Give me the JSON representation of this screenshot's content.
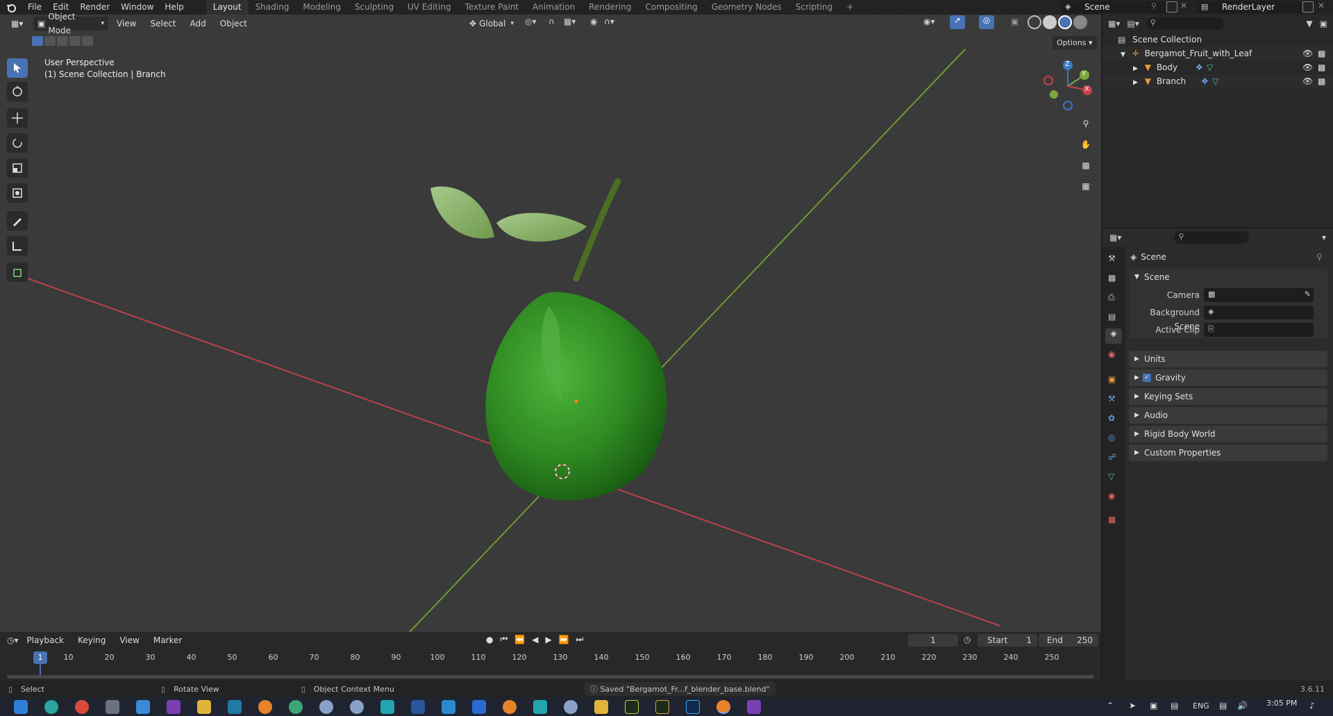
{
  "topbar": {
    "menus": [
      "File",
      "Edit",
      "Render",
      "Window",
      "Help"
    ],
    "workspaces": [
      "Layout",
      "Shading",
      "Modeling",
      "Sculpting",
      "UV Editing",
      "Texture Paint",
      "Animation",
      "Rendering",
      "Compositing",
      "Geometry Nodes",
      "Scripting"
    ],
    "active_workspace": "Layout",
    "add_tab": "+",
    "scene": "Scene",
    "view_layer": "RenderLayer"
  },
  "viewport": {
    "mode": "Object Mode",
    "menus": [
      "View",
      "Select",
      "Add",
      "Object"
    ],
    "orientation": "Global",
    "options": "Options",
    "info_line1": "User Perspective",
    "info_line2": "(1) Scene Collection | Branch",
    "gizmo_axes": [
      "X",
      "Y",
      "Z"
    ]
  },
  "outliner": {
    "root": "Scene Collection",
    "items": [
      {
        "name": "Bergamot_Fruit_with_Leaf",
        "icon": "empty-icon"
      },
      {
        "name": "Body",
        "icon": "mesh-icon"
      },
      {
        "name": "Branch",
        "icon": "mesh-icon"
      }
    ]
  },
  "properties": {
    "context": "Scene",
    "section": "Scene",
    "fields": [
      {
        "label": "Camera",
        "value": ""
      },
      {
        "label": "Background Scene",
        "value": ""
      },
      {
        "label": "Active Clip",
        "value": ""
      }
    ],
    "panels": [
      "Units",
      "Gravity",
      "Keying Sets",
      "Audio",
      "Rigid Body World",
      "Custom Properties"
    ],
    "gravity_enabled": true
  },
  "timeline": {
    "menus": [
      "Playback",
      "Keying",
      "View",
      "Marker"
    ],
    "current_frame": "1",
    "start_label": "Start",
    "start": "1",
    "end_label": "End",
    "end": "250",
    "ticks": [
      "1",
      "10",
      "20",
      "30",
      "40",
      "50",
      "60",
      "70",
      "80",
      "90",
      "100",
      "110",
      "120",
      "130",
      "140",
      "150",
      "160",
      "170",
      "180",
      "190",
      "200",
      "210",
      "220",
      "230",
      "240",
      "250"
    ]
  },
  "statusbar": {
    "select": "Select",
    "rotate": "Rotate View",
    "context_menu": "Object Context Menu",
    "saved": "Saved \"Bergamot_Fr...f_blender_base.blend\"",
    "version": "3.6.11"
  },
  "taskbar": {
    "lang": "ENG",
    "time": "3:05 PM"
  },
  "colors": {
    "accent": "#4772b3",
    "axis_x": "#c8404a",
    "axis_y": "#7aa83a",
    "axis_z": "#3a78c8",
    "fruit": "#3f9b2e"
  }
}
